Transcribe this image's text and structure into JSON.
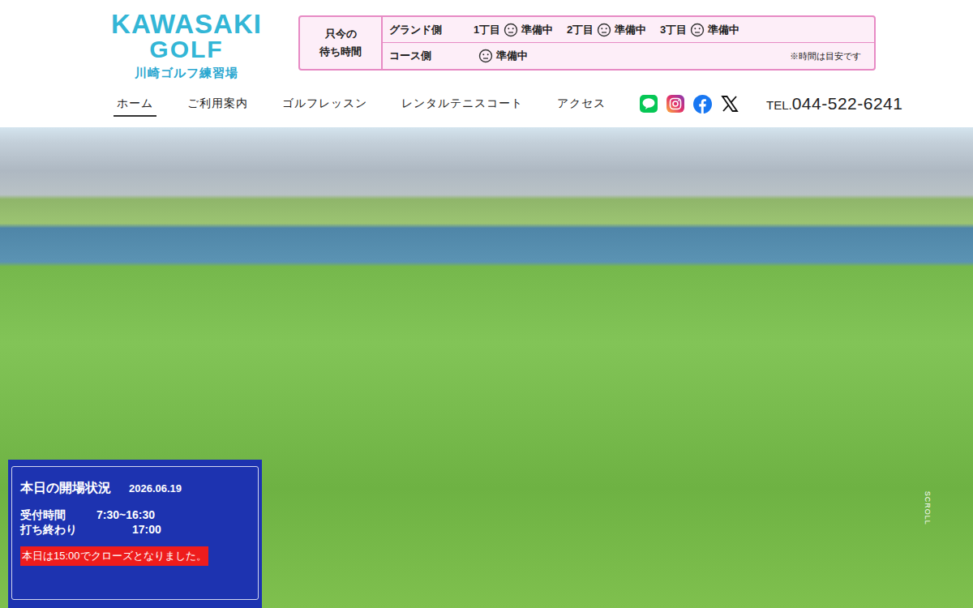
{
  "logo": {
    "title": "KAWASAKI",
    "subtitle": "GOLF",
    "name": "川崎ゴルフ練習場"
  },
  "wait": {
    "heading": [
      "只今の",
      "待ち時間"
    ],
    "rows": [
      {
        "label": "グランド側",
        "slots": [
          {
            "label": "1丁目",
            "status": "準備中"
          },
          {
            "label": "2丁目",
            "status": "準備中"
          },
          {
            "label": "3丁目",
            "status": "準備中"
          }
        ]
      },
      {
        "label": "コース側",
        "slots": [
          {
            "status": "準備中"
          }
        ]
      }
    ],
    "note": "※時間は目安です"
  },
  "nav": [
    {
      "label": "ホーム",
      "selected": true
    },
    {
      "label": "ご利用案内",
      "selected": false
    },
    {
      "label": "ゴルフレッスン",
      "selected": false
    },
    {
      "label": "レンタルテニスコート",
      "selected": false
    },
    {
      "label": "アクセス",
      "selected": false
    }
  ],
  "tel": {
    "prefix": "TEL.",
    "number": "044-522-6241"
  },
  "status": {
    "title": "本日の開場状況",
    "date": "2026.06.19",
    "rows": [
      {
        "label": "受付時間",
        "value": "7:30~16:30"
      },
      {
        "label": "打ち終わり",
        "value": "17:00"
      }
    ],
    "notice": "本日は15:00でクローズとなりました。"
  },
  "scroll": "SCROLL"
}
